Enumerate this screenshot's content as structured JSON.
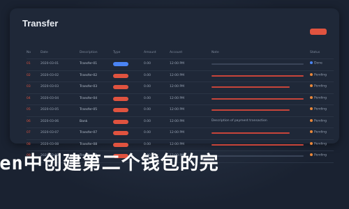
{
  "window": {
    "title": "Transfer"
  },
  "toolbar": {
    "top_button_label": ""
  },
  "table": {
    "headers": [
      "No",
      "Date",
      "Description",
      "Type",
      "Amount",
      "Account",
      "Note",
      "Status"
    ],
    "rows": [
      {
        "n": "01",
        "date": "2020-03-01",
        "desc": "Transfer-01",
        "pill": "blue",
        "x": "0.00",
        "y": "12:00 PM",
        "note": "",
        "bar": "faint",
        "status": "Done",
        "dot": "blue"
      },
      {
        "n": "02",
        "date": "2020-03-02",
        "desc": "Transfer-02",
        "pill": "red",
        "x": "0.00",
        "y": "12:00 PM",
        "note": "",
        "bar": "red",
        "status": "Pending",
        "dot": "orange"
      },
      {
        "n": "03",
        "date": "2020-03-03",
        "desc": "Transfer-03",
        "pill": "red",
        "x": "0.00",
        "y": "12:00 PM",
        "note": "",
        "bar": "red",
        "status": "Pending",
        "dot": "orange"
      },
      {
        "n": "04",
        "date": "2020-03-04",
        "desc": "Transfer-04",
        "pill": "red",
        "x": "0.00",
        "y": "12:00 PM",
        "note": "",
        "bar": "red",
        "status": "Pending",
        "dot": "orange"
      },
      {
        "n": "05",
        "date": "2020-03-05",
        "desc": "Transfer-05",
        "pill": "red",
        "x": "0.00",
        "y": "12:00 PM",
        "note": "",
        "bar": "red",
        "status": "Pending",
        "dot": "orange"
      },
      {
        "n": "06",
        "date": "2020-03-06",
        "desc": "Bank",
        "pill": "red",
        "x": "0.00",
        "y": "12:00 PM",
        "note": "Description of payment transaction",
        "bar": "text",
        "status": "Pending",
        "dot": "orange"
      },
      {
        "n": "07",
        "date": "2020-03-07",
        "desc": "Transfer-07",
        "pill": "red",
        "x": "0.00",
        "y": "12:00 PM",
        "note": "",
        "bar": "red",
        "status": "Pending",
        "dot": "orange"
      },
      {
        "n": "08",
        "date": "2020-03-08",
        "desc": "Transfer-08",
        "pill": "red",
        "x": "0.00",
        "y": "12:00 PM",
        "note": "",
        "bar": "red",
        "status": "Pending",
        "dot": "orange"
      },
      {
        "n": "09",
        "date": "2020-03-09",
        "desc": "Transfer-09",
        "pill": "red",
        "x": "0.00",
        "y": "12:00 PM",
        "note": "",
        "bar": "faint",
        "status": "Pending",
        "dot": "orange"
      }
    ]
  },
  "caption": "ken中创建第二个钱包的完"
}
